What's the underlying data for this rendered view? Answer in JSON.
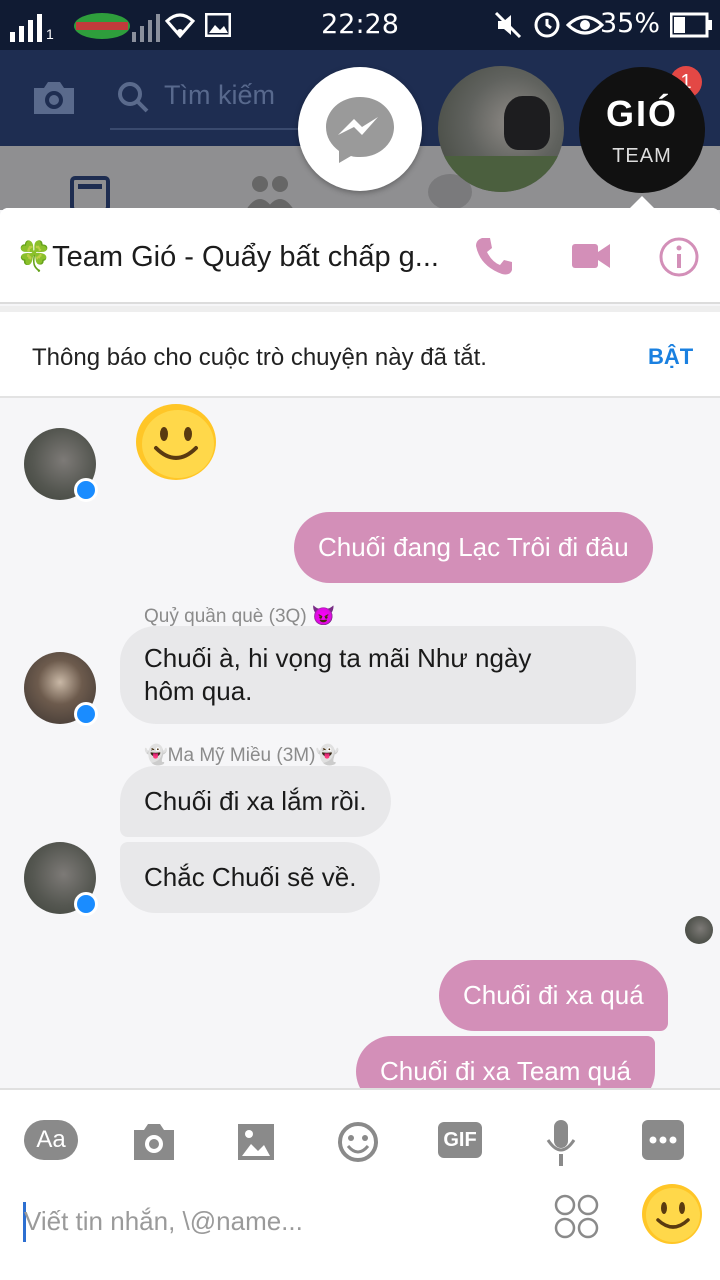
{
  "status_bar": {
    "time": "22:28",
    "battery": "35%",
    "carrier_sim": "1"
  },
  "fb_header": {
    "search_placeholder": "Tìm kiếm",
    "notification_count": "1"
  },
  "chat_heads": {
    "team_label_top": "GIÓ",
    "team_label_bottom": "TEAM"
  },
  "conversation": {
    "title": "🍀Team Gió - Quẩy bất chấp g...",
    "notice": "Thông báo cho cuộc trò chuyện này đã tắt.",
    "notice_action": "BẬT"
  },
  "messages": [
    {
      "id": "m1",
      "from": "other",
      "sticker": "smile"
    },
    {
      "id": "m2",
      "from": "me",
      "text": "Chuối đang Lạc Trôi đi đâu"
    },
    {
      "id": "m3",
      "from": "other",
      "sender": "Quỷ quần què (3Q) 😈",
      "text_line1": "Chuối à, hi vọng ta mãi Như ngày",
      "text_line2": "hôm qua."
    },
    {
      "id": "m4",
      "from": "other",
      "sender": "👻Ma Mỹ Miều (3M)👻",
      "text": "Chuối đi xa lắm rồi."
    },
    {
      "id": "m5",
      "from": "other",
      "text": "Chắc Chuối sẽ về."
    },
    {
      "id": "m6",
      "from": "me",
      "text": "Chuối đi xa quá"
    },
    {
      "id": "m7",
      "from": "me",
      "text": "Chuối đi xa Team quá"
    }
  ],
  "composer": {
    "aa_label": "Aa",
    "gif_label": "GIF",
    "placeholder": "Viết tin nhắn, \\@name..."
  },
  "colors": {
    "accent_pink": "#d38fb8",
    "header_dark": "#1e2d51",
    "link_blue": "#1a80e0",
    "messenger_blue": "#1a8cff"
  }
}
